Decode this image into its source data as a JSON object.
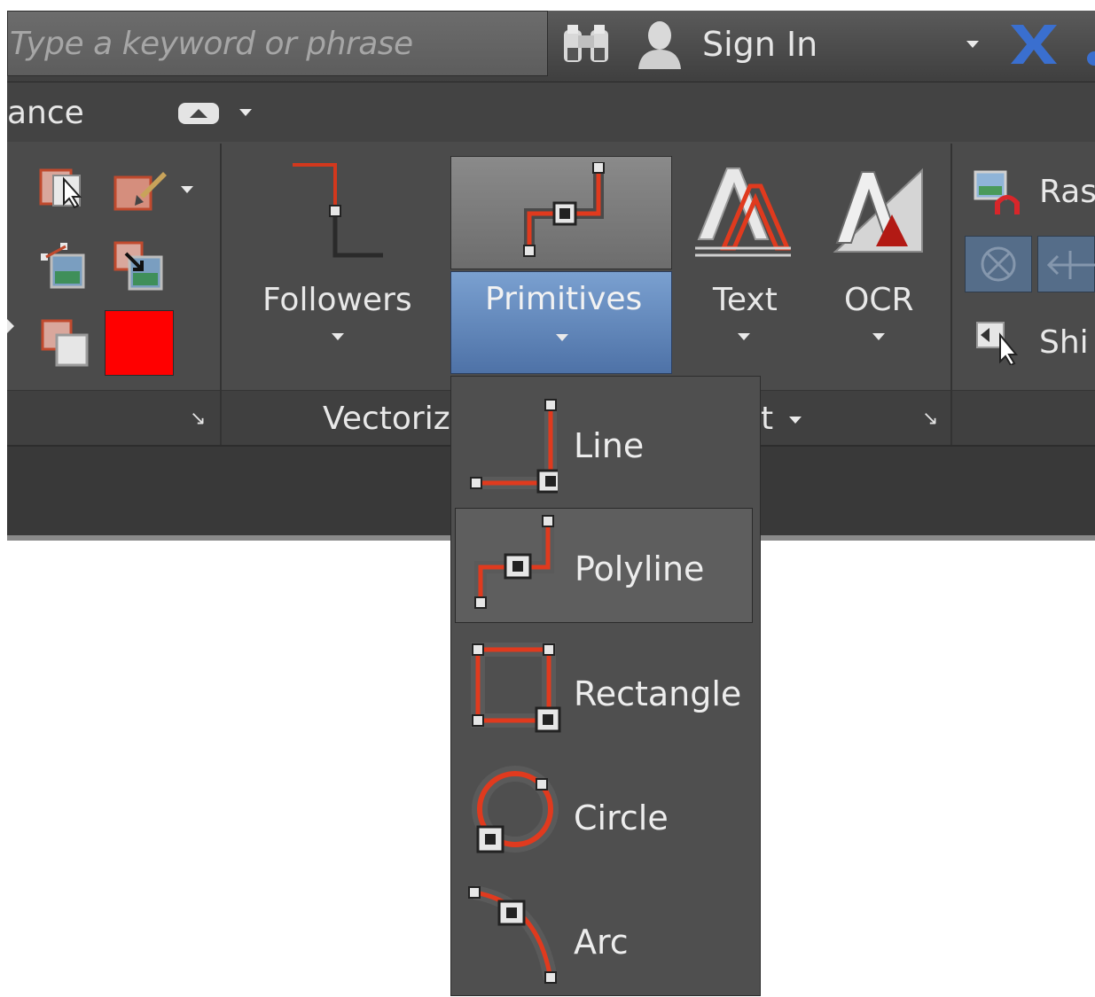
{
  "topbar": {
    "search_placeholder": "Type a keyword or phrase",
    "signin_label": "Sign In"
  },
  "tabrow": {
    "partial_tab": "ance"
  },
  "ribbon": {
    "followers_label": "Followers",
    "primitives_label": "Primitives",
    "text_label": "Text",
    "ocr_label": "OCR",
    "raster_label": "Ras",
    "shift_label": "Shi",
    "vectorize_panel_label": "Vectoriz",
    "text_panel_label_tail": "t",
    "color_swatch": "#ff0000"
  },
  "dropdown": {
    "items": [
      {
        "label": "Line",
        "icon": "line-icon"
      },
      {
        "label": "Polyline",
        "icon": "polyline-icon"
      },
      {
        "label": "Rectangle",
        "icon": "rectangle-icon"
      },
      {
        "label": "Circle",
        "icon": "circle-icon"
      },
      {
        "label": "Arc",
        "icon": "arc-icon"
      }
    ],
    "highlighted": "Polyline"
  },
  "colors": {
    "accent_red": "#e03a1e",
    "selected_blue": "#5a7fb4",
    "ribbon_bg": "#4b4b4b"
  }
}
